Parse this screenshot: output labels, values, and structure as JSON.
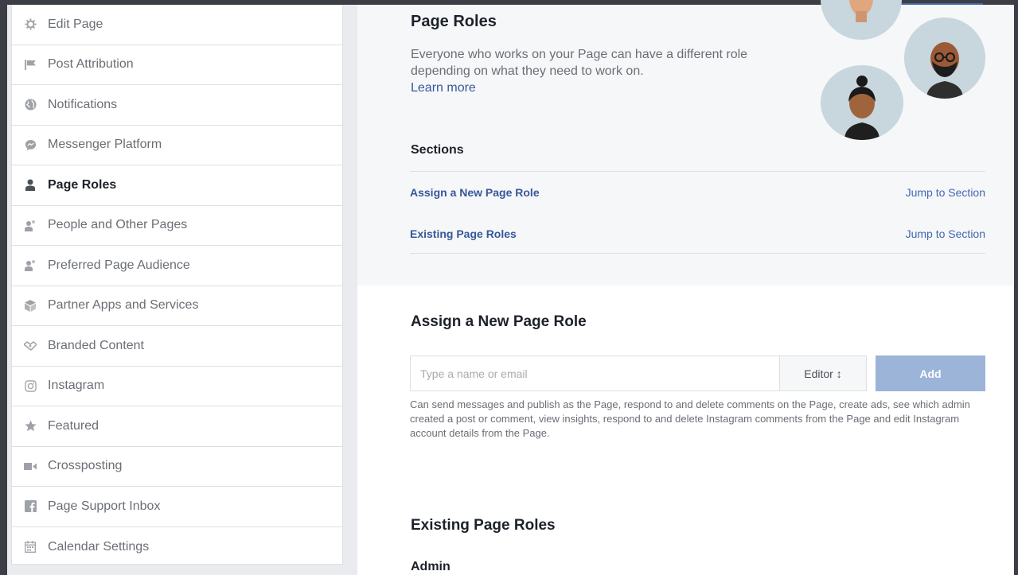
{
  "sidebar": {
    "items": [
      {
        "label": "Edit Page",
        "icon": "gear-icon"
      },
      {
        "label": "Post Attribution",
        "icon": "flag-icon"
      },
      {
        "label": "Notifications",
        "icon": "globe-icon"
      },
      {
        "label": "Messenger Platform",
        "icon": "chat-bubble-icon"
      },
      {
        "label": "Page Roles",
        "icon": "person-icon",
        "active": true
      },
      {
        "label": "People and Other Pages",
        "icon": "people-icon"
      },
      {
        "label": "Preferred Page Audience",
        "icon": "people-icon"
      },
      {
        "label": "Partner Apps and Services",
        "icon": "cube-icon"
      },
      {
        "label": "Branded Content",
        "icon": "handshake-icon"
      },
      {
        "label": "Instagram",
        "icon": "instagram-icon"
      },
      {
        "label": "Featured",
        "icon": "star-icon"
      },
      {
        "label": "Crossposting",
        "icon": "video-camera-icon"
      },
      {
        "label": "Page Support Inbox",
        "icon": "facebook-icon"
      },
      {
        "label": "Calendar Settings",
        "icon": "calendar-icon"
      }
    ]
  },
  "header": {
    "title": "Page Roles",
    "intro": "Everyone who works on your Page can have a different role depending on what they need to work on.",
    "learn_more": "Learn more"
  },
  "sections": {
    "label": "Sections",
    "rows": [
      {
        "name": "Assign a New Page Role",
        "jump": "Jump to Section"
      },
      {
        "name": "Existing Page Roles",
        "jump": "Jump to Section"
      }
    ]
  },
  "assign": {
    "title": "Assign a New Page Role",
    "input_placeholder": "Type a name or email",
    "role": "Editor ↕",
    "add_label": "Add",
    "description": "Can send messages and publish as the Page, respond to and delete comments on the Page, create ads, see which admin created a post or comment, view insights, respond to and delete Instagram comments from the Page and edit Instagram account details from the Page."
  },
  "existing": {
    "title": "Existing Page Roles",
    "admin_label": "Admin"
  },
  "colors": {
    "link": "#365899",
    "add_button": "#9cb4d8",
    "avatar_bg": "#c8d6dd"
  }
}
